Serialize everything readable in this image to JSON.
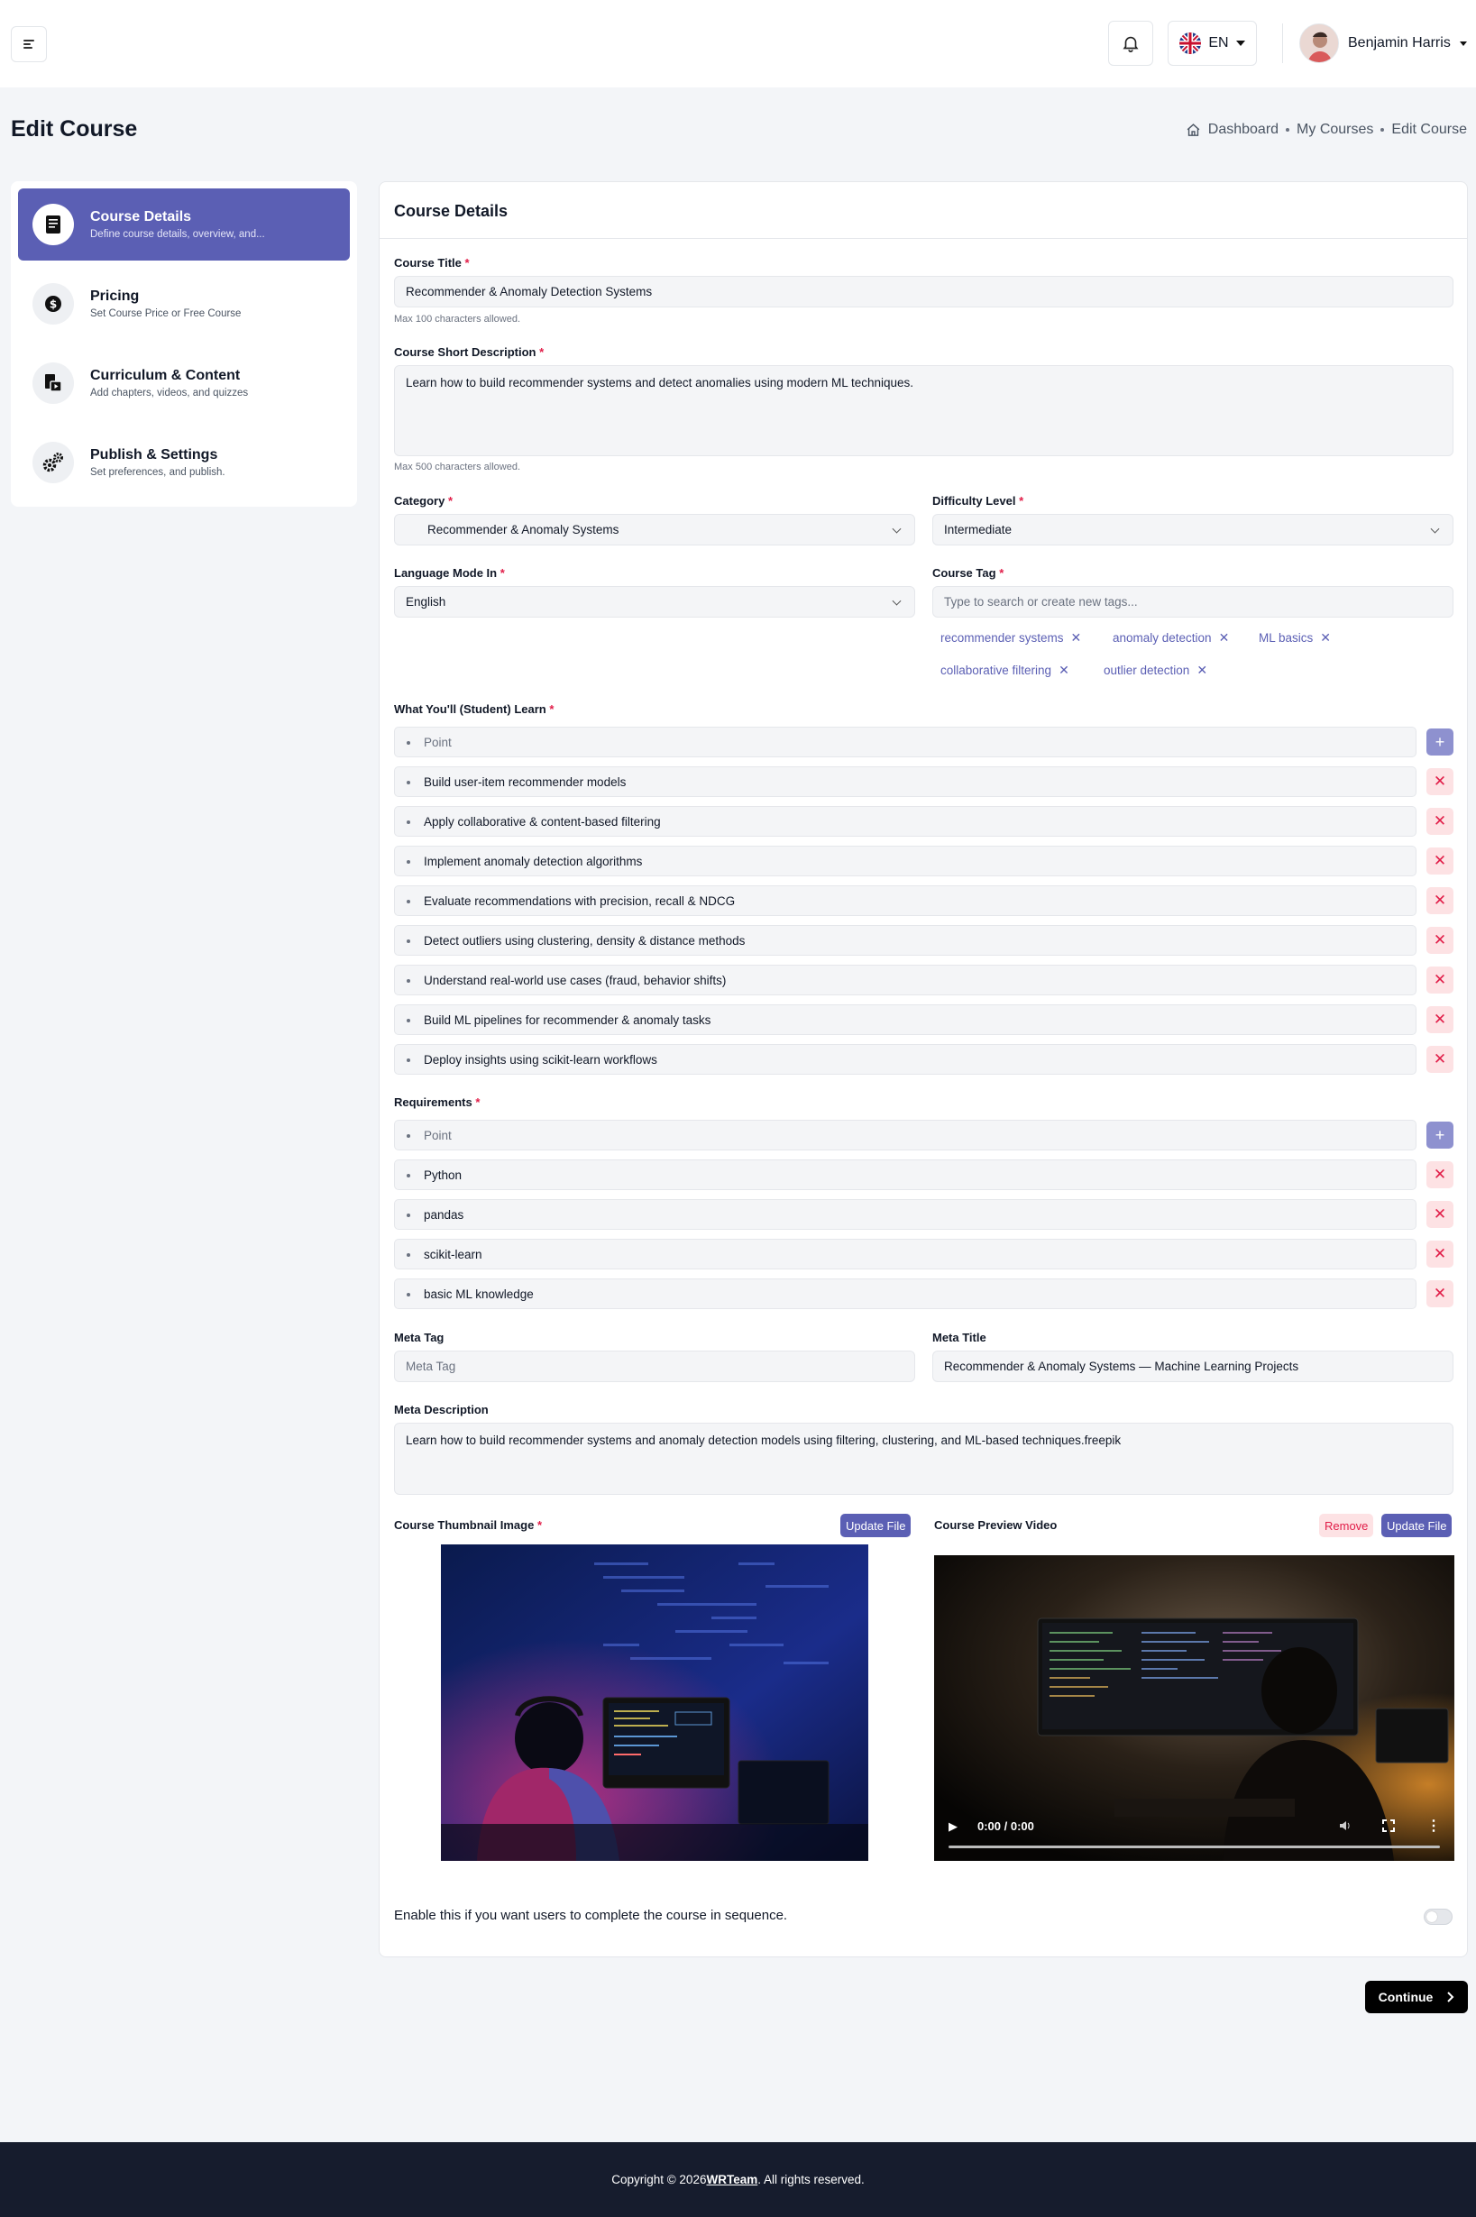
{
  "header": {
    "language": "EN",
    "user_name": "Benjamin Harris"
  },
  "page": {
    "title": "Edit Course",
    "breadcrumb": [
      "Dashboard",
      "My Courses",
      "Edit Course"
    ]
  },
  "sidebar": {
    "steps": [
      {
        "title": "Course Details",
        "subtitle": "Define course details, overview, and...",
        "icon": "document-icon"
      },
      {
        "title": "Pricing",
        "subtitle": "Set Course Price or Free Course",
        "icon": "dollar-icon"
      },
      {
        "title": "Curriculum & Content",
        "subtitle": "Add chapters, videos, and quizzes",
        "icon": "curriculum-icon"
      },
      {
        "title": "Publish & Settings",
        "subtitle": "Set preferences, and publish.",
        "icon": "gears-icon"
      }
    ]
  },
  "form": {
    "card_title": "Course Details",
    "course_title_label": "Course Title",
    "course_title_value": "Recommender & Anomaly Detection Systems",
    "course_title_hint": "Max 100 characters allowed.",
    "short_desc_label": "Course Short Description",
    "short_desc_value": "Learn how to build recommender systems and detect anomalies using modern ML techniques.",
    "short_desc_hint": "Max 500 characters allowed.",
    "category_label": "Category",
    "category_value": "Recommender & Anomaly Systems",
    "difficulty_label": "Difficulty Level",
    "difficulty_value": "Intermediate",
    "language_label": "Language Mode In",
    "language_value": "English",
    "tag_label": "Course Tag",
    "tag_placeholder": "Type to search or create new tags...",
    "tags": [
      "recommender systems",
      "anomaly detection",
      "ML basics",
      "collaborative filtering",
      "outlier detection"
    ],
    "learn_label": "What You'll (Student) Learn",
    "point_placeholder": "Point",
    "learn_points": [
      "Build user-item recommender models",
      "Apply collaborative & content-based filtering",
      "Implement anomaly detection algorithms",
      "Evaluate recommendations with precision, recall & NDCG",
      "Detect outliers using clustering, density & distance methods",
      "Understand real-world use cases (fraud, behavior shifts)",
      "Build ML pipelines for recommender & anomaly tasks",
      "Deploy insights using scikit-learn workflows"
    ],
    "requirements_label": "Requirements",
    "requirements": [
      "Python",
      "pandas",
      "scikit-learn",
      "basic ML knowledge"
    ],
    "meta_tag_label": "Meta Tag",
    "meta_tag_placeholder": "Meta Tag",
    "meta_title_label": "Meta Title",
    "meta_title_value": "Recommender & Anomaly Systems — Machine Learning Projects",
    "meta_desc_label": "Meta Description",
    "meta_desc_value": "Learn how to build recommender systems and anomaly detection models using filtering, clustering, and ML-based techniques.freepik",
    "thumb_label": "Course Thumbnail Image",
    "update_file": "Update File",
    "video_label": "Course Preview Video",
    "remove": "Remove",
    "video_time": "0:00 / 0:00",
    "sequence_text": "Enable this if you want users to complete the course in sequence.",
    "continue": "Continue"
  },
  "footer": {
    "prefix": "Copyright © 2026 ",
    "brand": "WRTeam",
    "suffix": ". All rights reserved."
  },
  "colors": {
    "primary": "#5b5fb4",
    "danger": "#e11d48",
    "footer_bg": "#161c2d"
  }
}
